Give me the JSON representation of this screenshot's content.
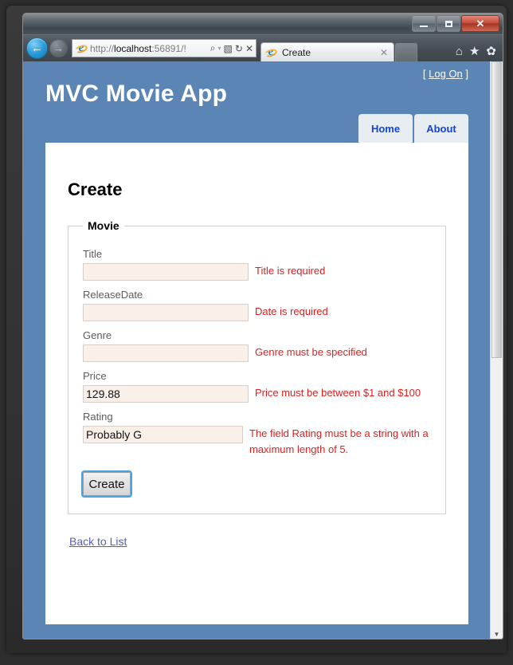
{
  "window": {
    "minimize_label": "Minimize",
    "maximize_label": "Maximize",
    "close_label": "✕"
  },
  "browser": {
    "back_glyph": "←",
    "forward_glyph": "→",
    "url_scheme": "http://",
    "url_host": "localhost",
    "url_rest": ":56891/!",
    "search_glyph": "⌕",
    "dropdown_glyph": "▾",
    "compat_glyph": "▧",
    "refresh_glyph": "↻",
    "stop_glyph": "✕",
    "tab_title": "Create",
    "tab_close_glyph": "✕",
    "home_glyph": "⌂",
    "favorites_glyph": "★",
    "tools_glyph": "✿"
  },
  "site": {
    "title": "MVC Movie App",
    "logon_prefix": "[ ",
    "logon_label": "Log On",
    "logon_suffix": " ]",
    "nav": [
      {
        "label": "Home"
      },
      {
        "label": "About"
      }
    ]
  },
  "main": {
    "page_title": "Create",
    "fieldset_legend": "Movie",
    "fields": [
      {
        "label": "Title",
        "value": "",
        "error": "Title is required",
        "focused": false
      },
      {
        "label": "ReleaseDate",
        "value": "",
        "error": "Date is required",
        "focused": false
      },
      {
        "label": "Genre",
        "value": "",
        "error": "Genre must be specified",
        "focused": false
      },
      {
        "label": "Price",
        "value": "129.88",
        "error": "Price must be between $1 and $100",
        "focused": false
      },
      {
        "label": "Rating",
        "value": "Probably G",
        "error": "The field Rating must be a string with a maximum length of 5.",
        "focused": true
      }
    ],
    "submit_label": "Create",
    "back_link_label": "Back to List"
  },
  "colors": {
    "page_blue": "#5a85b5",
    "nav_tab_bg": "#e8edf2",
    "nav_tab_text": "#1144dd",
    "input_bg": "#faf0ea",
    "input_border": "#d9cec9",
    "error_text": "#e02020",
    "link": "#5b5bb0",
    "focus_ring": "#4aa3e0"
  }
}
